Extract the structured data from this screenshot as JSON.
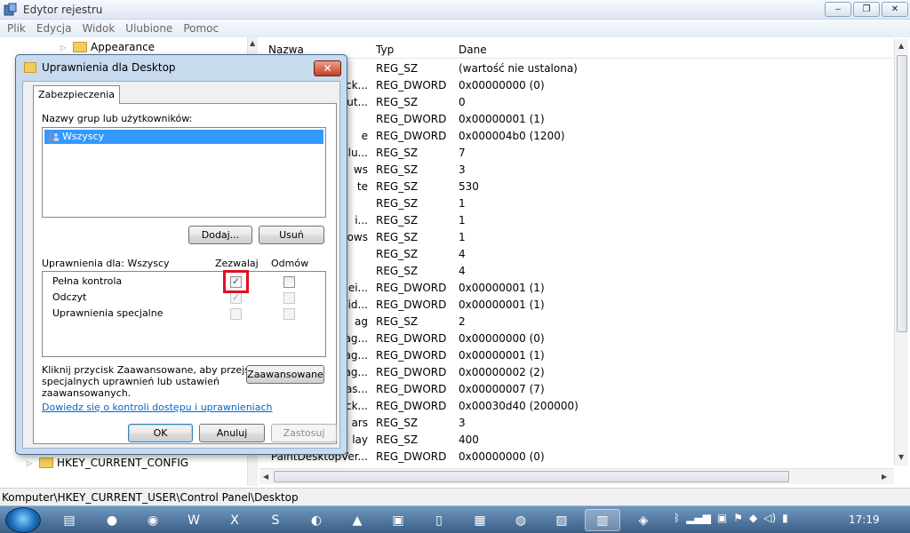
{
  "window": {
    "title": "Edytor rejestru",
    "controls": [
      "‒",
      "❐",
      "✕"
    ]
  },
  "menu": [
    "Plik",
    "Edycja",
    "Widok",
    "Ulubione",
    "Pomoc"
  ],
  "tree": {
    "top_item": "Appearance",
    "bottom_item": "HKEY_CURRENT_CONFIG"
  },
  "list": {
    "headers": {
      "name": "Nazwa",
      "type": "Typ",
      "data": "Dane"
    },
    "rows": [
      {
        "name": "",
        "type": "REG_SZ",
        "data": "(wartość nie ustalona)"
      },
      {
        "name": "ck...",
        "type": "REG_DWORD",
        "data": "0x00000000 (0)"
      },
      {
        "name": "ut...",
        "type": "REG_SZ",
        "data": "0"
      },
      {
        "name": "",
        "type": "REG_DWORD",
        "data": "0x00000001 (1)"
      },
      {
        "name": "e",
        "type": "REG_DWORD",
        "data": "0x000004b0 (1200)"
      },
      {
        "name": "lu...",
        "type": "REG_SZ",
        "data": "7"
      },
      {
        "name": "ws",
        "type": "REG_SZ",
        "data": "3"
      },
      {
        "name": "te",
        "type": "REG_SZ",
        "data": "530"
      },
      {
        "name": "",
        "type": "REG_SZ",
        "data": "1"
      },
      {
        "name": "i...",
        "type": "REG_SZ",
        "data": "1"
      },
      {
        "name": "ows",
        "type": "REG_SZ",
        "data": "1"
      },
      {
        "name": "",
        "type": "REG_SZ",
        "data": "4"
      },
      {
        "name": "",
        "type": "REG_SZ",
        "data": "4"
      },
      {
        "name": "ei...",
        "type": "REG_DWORD",
        "data": "0x00000001 (1)"
      },
      {
        "name": "Vid...",
        "type": "REG_DWORD",
        "data": "0x00000001 (1)"
      },
      {
        "name": "ag",
        "type": "REG_SZ",
        "data": "2"
      },
      {
        "name": "ag...",
        "type": "REG_DWORD",
        "data": "0x00000000 (0)"
      },
      {
        "name": "ag...",
        "type": "REG_DWORD",
        "data": "0x00000001 (1)"
      },
      {
        "name": "ag...",
        "type": "REG_DWORD",
        "data": "0x00000002 (2)"
      },
      {
        "name": "as...",
        "type": "REG_DWORD",
        "data": "0x00000007 (7)"
      },
      {
        "name": "ck...",
        "type": "REG_DWORD",
        "data": "0x00030d40 (200000)"
      },
      {
        "name": "ars",
        "type": "REG_SZ",
        "data": "3"
      },
      {
        "name": "lay",
        "type": "REG_SZ",
        "data": "400"
      },
      {
        "name": "PaintDesktopVer...",
        "type": "REG_DWORD",
        "data": "0x00000000 (0)"
      }
    ]
  },
  "statusbar": {
    "path": "Komputer\\HKEY_CURRENT_USER\\Control Panel\\Desktop"
  },
  "dialog": {
    "title": "Uprawnienia dla Desktop",
    "close": "✕",
    "tab": "Zabezpieczenia",
    "groups_label": "Nazwy grup lub użytkowników:",
    "groups": [
      "Wszyscy"
    ],
    "add_button": "Dodaj...",
    "remove_button": "Usuń",
    "permissions_label": "Uprawnienia dla: Wszyscy",
    "allow_header": "Zezwalaj",
    "deny_header": "Odmów",
    "permissions": [
      {
        "name": "Pełna kontrola",
        "allow": true,
        "deny": false
      },
      {
        "name": "Odczyt",
        "allow": true,
        "deny": false
      },
      {
        "name": "Uprawnienia specjalne",
        "allow": false,
        "deny": false
      }
    ],
    "advanced_text_1": "Kliknij przycisk Zaawansowane, aby przejść do",
    "advanced_text_2": "specjalnych uprawnień lub ustawień",
    "advanced_text_3": "zaawansowanych.",
    "advanced_button": "Zaawansowane",
    "link": "Dowiedz się o kontroli dostępu i uprawnieniach",
    "ok": "OK",
    "cancel": "Anuluj",
    "apply": "Zastosuj"
  },
  "taskbar": {
    "clock": "17:19"
  }
}
